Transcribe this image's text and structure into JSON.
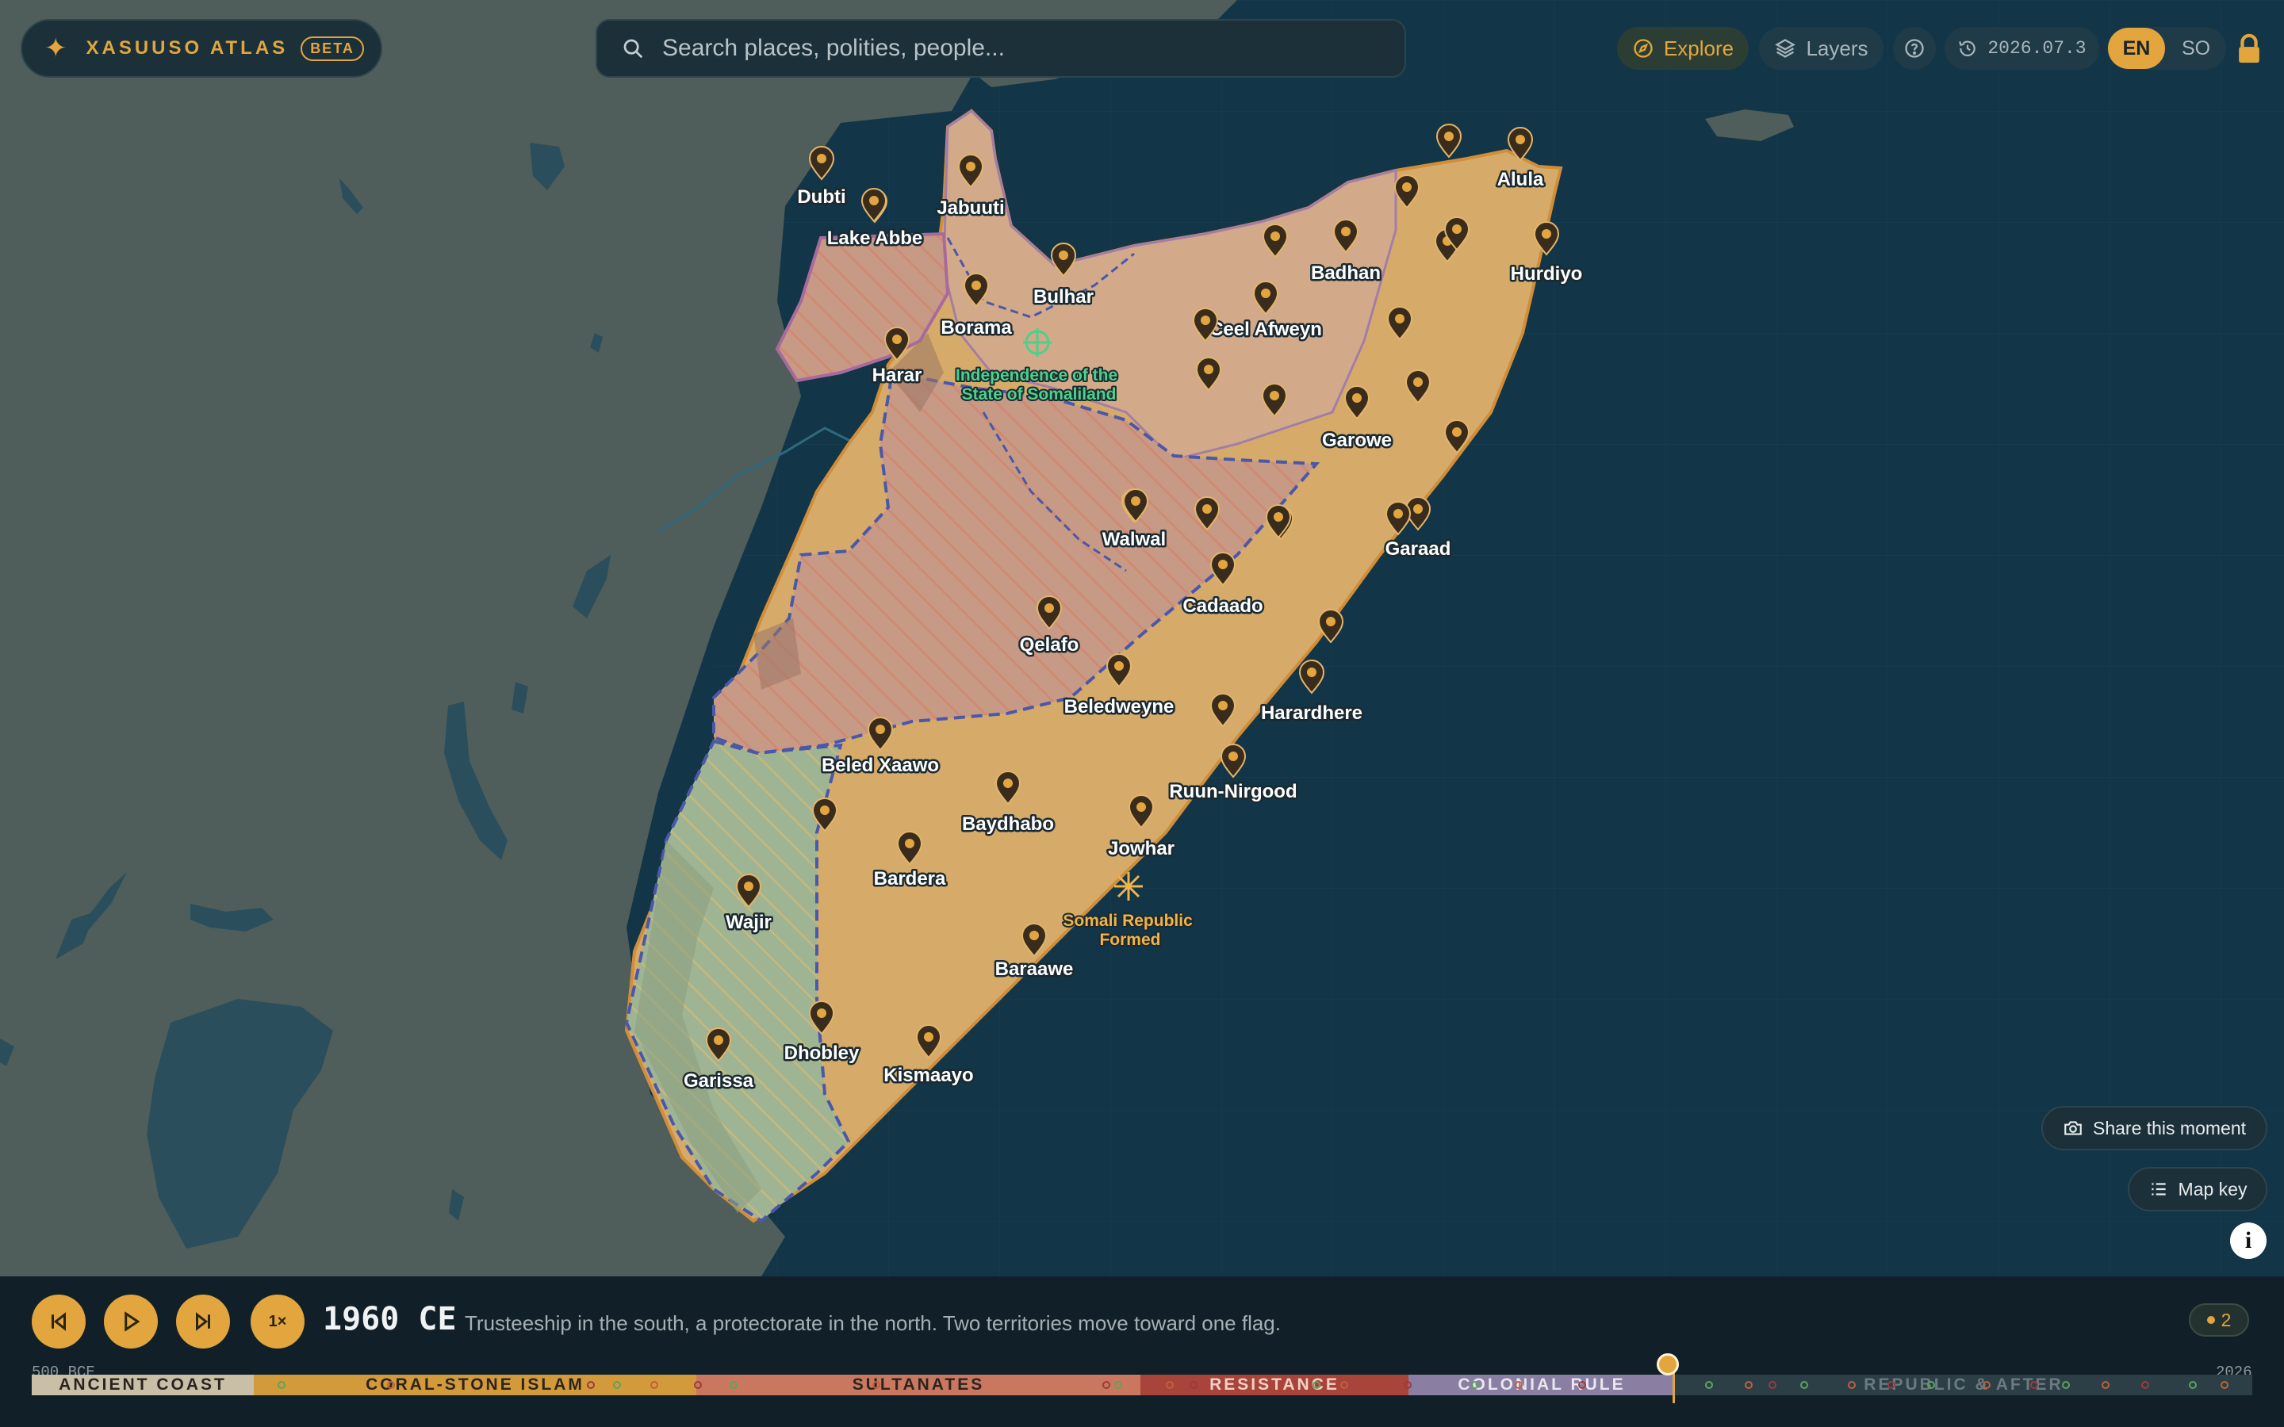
{
  "app": {
    "name": "XASUUSO ATLAS",
    "beta": "BETA",
    "version": "2026.07.3"
  },
  "search": {
    "placeholder": "Search places, polities, people..."
  },
  "nav": {
    "explore": "Explore",
    "layers": "Layers",
    "help_icon": "question-circle-icon",
    "version_icon": "history-icon"
  },
  "language": {
    "en": "EN",
    "so": "SO",
    "active": "EN"
  },
  "map": {
    "places": [
      "Dubti",
      "Jabuuti",
      "Lake Abbe",
      "Bulhar",
      "Borama",
      "Harar",
      "Badhan",
      "Ceel Afweyn",
      "Alula",
      "Hurdiyo",
      "Garowe",
      "Garaad",
      "Walwal",
      "Cadaado",
      "Qelafo",
      "Beledweyne",
      "Harardhere",
      "Beled Xaawo",
      "Ruun-Nirgood",
      "Baydhabo",
      "Jowhar",
      "Bardera",
      "Wajir",
      "Baraawe",
      "Dhobley",
      "Garissa",
      "Kismaayo"
    ],
    "events": [
      {
        "lines": [
          "Independence of the",
          "State of Somaliland"
        ],
        "color": "#4cd08a"
      },
      {
        "lines": [
          "Somali Republic",
          "Formed"
        ],
        "color": "#f2b347"
      }
    ]
  },
  "actions": {
    "share": "Share this moment",
    "map_key": "Map key",
    "info": "i"
  },
  "playback": {
    "speed": "1×",
    "year": "1960 CE",
    "caption": "Trusteeship in the south, a protectorate in the north. Two territories move toward one flag.",
    "badge_count": "2"
  },
  "timeline": {
    "start": "500 BCE",
    "end": "2026",
    "current_year": 1960,
    "eras": [
      {
        "label": "ANCIENT COAST",
        "color": "#c9bfa6"
      },
      {
        "label": "CORAL-STONE ISLAM",
        "color": "#d39a3b"
      },
      {
        "label": "SULTANATES",
        "color": "#c9785f"
      },
      {
        "label": "RESISTANCE",
        "color": "#a8443a"
      },
      {
        "label": "COLONIAL RULE",
        "color": "#8a7ea2"
      },
      {
        "label": "REPUBLIC & AFTER",
        "color": "#2c3f47"
      }
    ]
  }
}
